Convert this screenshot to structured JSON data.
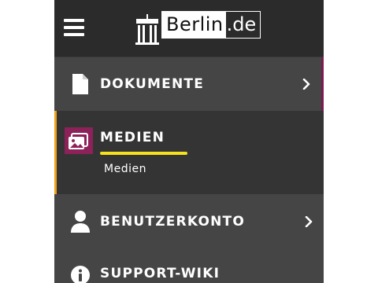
{
  "header": {
    "menu_icon": "hamburger-menu-icon",
    "logo": {
      "wordmark": "Berlin",
      "tld": ".de",
      "icon": "brandenburg-gate-icon"
    }
  },
  "nav": {
    "items": [
      {
        "label": "DOKUMENTE",
        "icon": "document-icon",
        "chevron": "chevron-right-icon"
      },
      {
        "label": "MEDIEN",
        "icon": "image-gallery-icon",
        "active": true,
        "sub_label": "Medien"
      },
      {
        "label": "BENUTZERKONTO",
        "icon": "user-icon",
        "chevron": "chevron-right-icon"
      },
      {
        "label": "SUPPORT-WIKI",
        "icon": "info-circle-icon"
      }
    ]
  },
  "colors": {
    "sidebar_bg": "#3b3b3b",
    "header_bg": "#2b2b2b",
    "active_accent": "#f0a21b",
    "active_underline": "#f5e11d",
    "media_icon_bg": "#8c2259"
  }
}
